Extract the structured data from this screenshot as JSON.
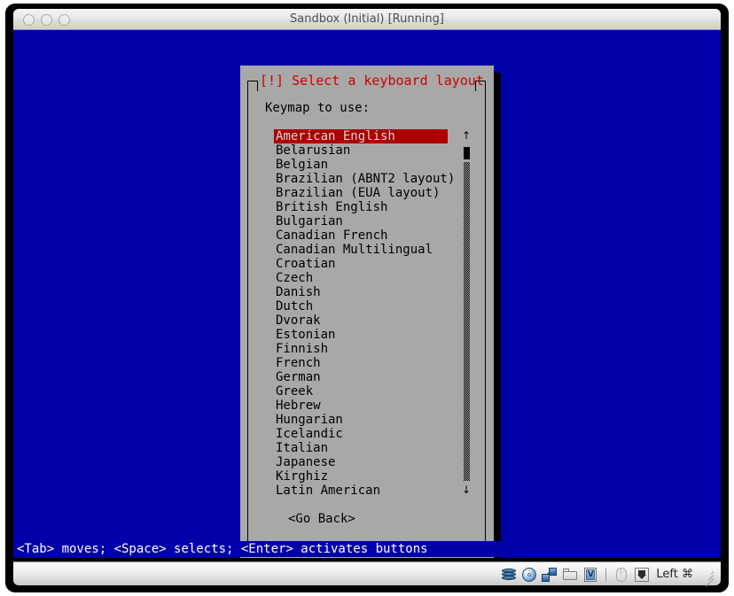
{
  "window": {
    "title": "Sandbox (Initial) [Running]",
    "traffic_lights": [
      "close",
      "minimize",
      "zoom"
    ]
  },
  "console": {
    "background_color": "#0000a8",
    "status_line": "<Tab> moves; <Space> selects; <Enter> activates buttons"
  },
  "dialog": {
    "title": "[!] Select a keyboard layout",
    "title_color": "#cc0000",
    "background_color": "#a8a8a8",
    "prompt": "Keymap to use:",
    "selected_index": 0,
    "selection_bg": "#aa0000",
    "items": [
      "American English",
      "Belarusian",
      "Belgian",
      "Brazilian (ABNT2 layout)",
      "Brazilian (EUA layout)",
      "British English",
      "Bulgarian",
      "Canadian French",
      "Canadian Multilingual",
      "Croatian",
      "Czech",
      "Danish",
      "Dutch",
      "Dvorak",
      "Estonian",
      "Finnish",
      "French",
      "German",
      "Greek",
      "Hebrew",
      "Hungarian",
      "Icelandic",
      "Italian",
      "Japanese",
      "Kirghiz",
      "Latin American"
    ],
    "scrollbar": {
      "arrow_up": "↑",
      "arrow_down": "↓"
    },
    "go_back_label": "<Go Back>"
  },
  "tray": {
    "icons": [
      "hard-disk-icon",
      "optical-disc-icon",
      "network-icon",
      "shared-folder-icon",
      "vm-chip-icon",
      "mouse-icon",
      "host-key-icon"
    ],
    "chip_letter": "V",
    "host_key_label": "Left ⌘"
  }
}
